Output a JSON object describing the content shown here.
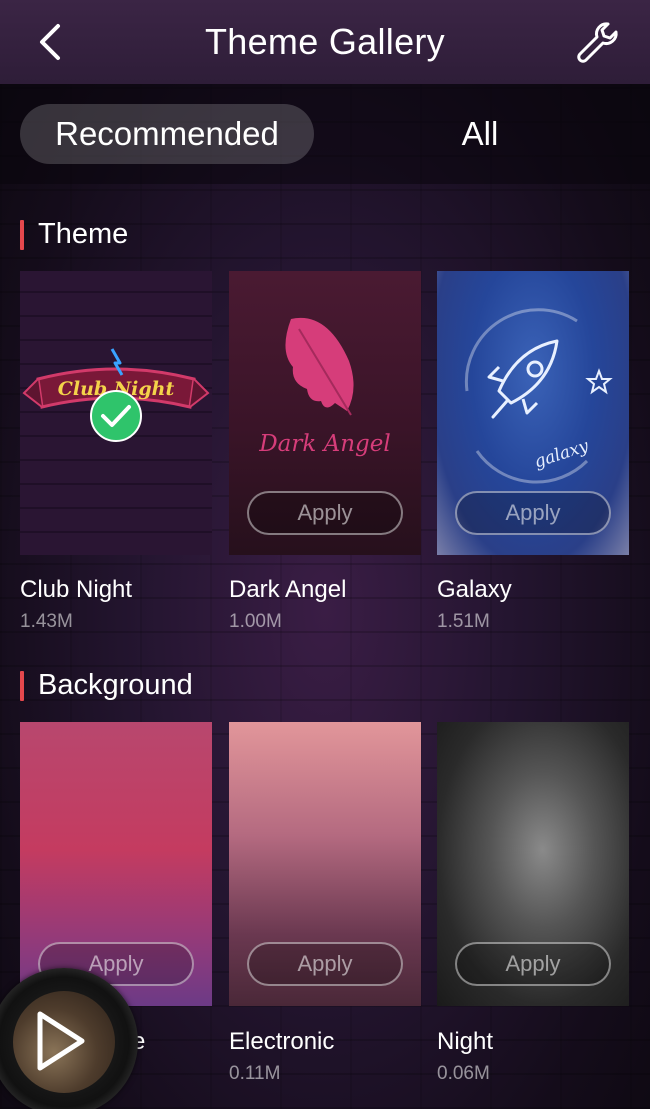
{
  "header": {
    "title": "Theme Gallery"
  },
  "tabs": [
    {
      "label": "Recommended",
      "active": true
    },
    {
      "label": "All",
      "active": false
    }
  ],
  "sections": {
    "theme": {
      "heading": "Theme",
      "items": [
        {
          "name": "Club Night",
          "size": "1.43M",
          "selected": true,
          "artwork_text": "Club Night"
        },
        {
          "name": "Dark Angel",
          "size": "1.00M",
          "apply_label": "Apply",
          "artwork_text": "Dark Angel"
        },
        {
          "name": "Galaxy",
          "size": "1.51M",
          "apply_label": "Apply",
          "artwork_text": "galaxy"
        }
      ]
    },
    "background": {
      "heading": "Background",
      "items": [
        {
          "name": "e",
          "size": "",
          "apply_label": "Apply"
        },
        {
          "name": "Electronic",
          "size": "0.11M",
          "apply_label": "Apply"
        },
        {
          "name": "Night",
          "size": "0.06M",
          "apply_label": "Apply"
        }
      ]
    }
  },
  "colors": {
    "accent_bar": "#e5484d",
    "selected_check": "#2fc46b"
  },
  "icons": {
    "back": "chevron-left-icon",
    "settings": "wrench-icon",
    "play": "play-icon",
    "selected": "check-circle-icon"
  }
}
